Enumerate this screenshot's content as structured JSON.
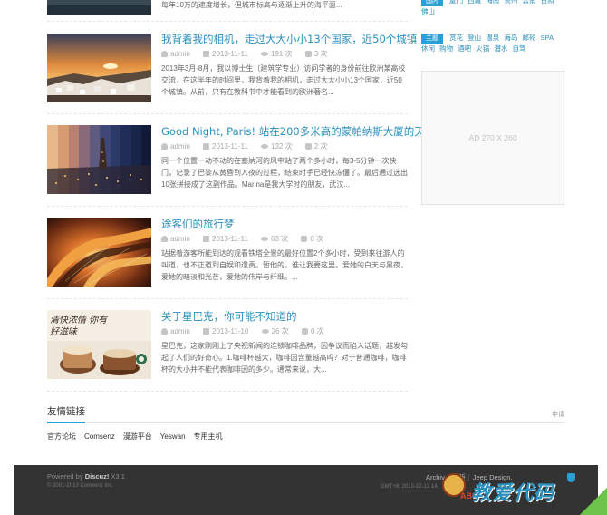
{
  "posts": [
    {
      "title": "",
      "excerpt": "每年10万的速度增长，但城市标高与逐渐上升的海平面...",
      "author": "",
      "date": "",
      "views": "",
      "comments": ""
    },
    {
      "title": "我背着我的相机，走过大大小小13个国家，近50个城镇",
      "author": "admin",
      "date": "2013-11-11",
      "views": "191 次",
      "comments": "3 次",
      "excerpt": "2013年3月-8月，我以博士生（建筑学专业）访问学者的身份前往欧洲某高校交流，在这半年的时间里，我背着我的相机，走过大大小小13个国家，近50个城镇。从前，只有在教科书中才能看到的欧洲著名..."
    },
    {
      "title": "Good Night, Paris! 站在200多米高的蒙帕纳斯大厦的天",
      "author": "admin",
      "date": "2013-11-11",
      "views": "132 次",
      "comments": "2 次",
      "excerpt": "同一个位置一动不动的在塞纳河的风中站了两个多小时，每3-5分钟一次快门，记录了巴黎从黄昏到入夜的过程，结束时手已经快冻僵了。最后通过选出10张拼接成了这副作品。Marina是我大学时的朋友，武汉..."
    },
    {
      "title": "途客们的旅行梦",
      "author": "admin",
      "date": "2013-11-11",
      "views": "63 次",
      "comments": "0 次",
      "excerpt": "站据着游客所能到达的观看铁塔全景的最好位置2个多小时，受到来往游人的叫道，也不正道到自娱和遗责。暂他的，谁让我要这里，爱她的白天与黑夜，爱她的暗淡和光芒，爱她的伟岸与纤细。..."
    },
    {
      "title": "关于星巴克，你可能不知道的",
      "author": "admin",
      "date": "2013-11-10",
      "views": "26 次",
      "comments": "0 次",
      "excerpt": "星巴克，这家刚刚上了央视新闻的连锁咖啡品牌，因争议而陷入话题，越发勾起了人们的好奇心。1.咖啡杯越大，咖啡因含量越高吗？对于普通咖啡，咖啡杯的大小并不能代表咖啡因的多少。通常来说，大..."
    }
  ],
  "thumb_captions": {
    "starbucks": "清快浓情 你有好滋味"
  },
  "sidebar": {
    "tags_top": {
      "label": "国内",
      "items": [
        "厦门",
        "西藏",
        "海南",
        "贵州",
        "云南",
        "日照",
        "佛山"
      ]
    },
    "tags_theme": {
      "label": "主题",
      "items": [
        "赏花",
        "登山",
        "温泉",
        "海岛",
        "邮轮",
        "SPA",
        "休闲",
        "购物",
        "酒吧",
        "火锅",
        "潜水",
        "自驾"
      ]
    },
    "ad": "AD 270 X 260"
  },
  "links": {
    "title": "友情链接",
    "apply": "申请",
    "items": [
      "官方论坛",
      "Comsenz",
      "漫游平台",
      "Yeswan",
      "专用主机"
    ]
  },
  "footer": {
    "powered_prefix": "Powered by",
    "powered_brand": "Discuz!",
    "powered_version": "X3.1",
    "copyright": "© 2001-2013 Comsenz Inc.",
    "links_a": "Archiv",
    "links_b": "强版",
    "links_c": "Jeep Design.",
    "gmt": "GMT+8, 2013-12-13 14:"
  },
  "watermark": {
    "text": "教爱代码",
    "sub": "ABC"
  },
  "colors": {
    "accent": "#2a8fbd",
    "label_bg": "#2a9fd6",
    "footer_bg": "#333333"
  }
}
